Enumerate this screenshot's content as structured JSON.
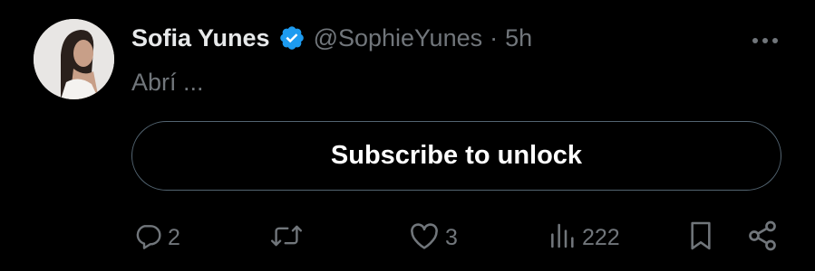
{
  "post": {
    "author_name": "Sofia Yunes",
    "handle": "@SophieYunes",
    "separator": "·",
    "timestamp": "5h",
    "text": "Abrí ...",
    "verified_icon": "verified-badge-icon",
    "verified_color": "#1d9bf0",
    "subscribe_label": "Subscribe to unlock"
  },
  "actions": {
    "replies": "2",
    "reposts": "",
    "likes": "3",
    "views": "222"
  },
  "colors": {
    "background": "#000000",
    "primary_text": "#e7e9ea",
    "secondary_text": "#71767b",
    "border": "#536471",
    "accent": "#1d9bf0"
  }
}
